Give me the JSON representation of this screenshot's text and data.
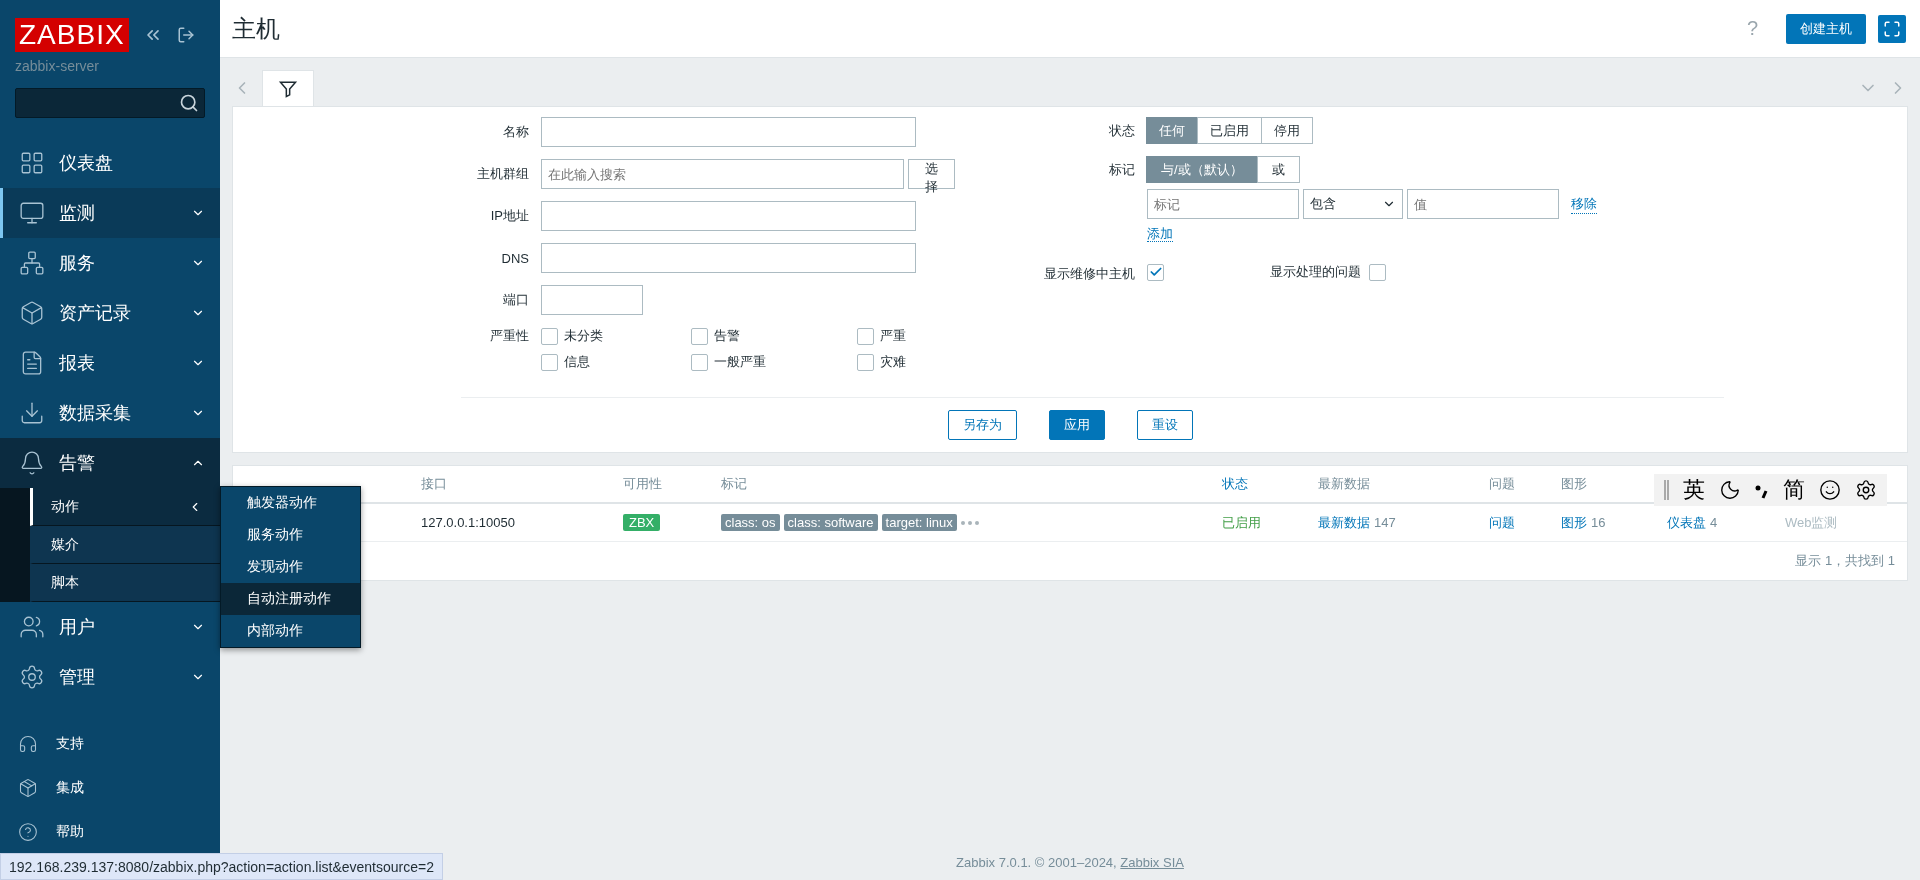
{
  "sidebar": {
    "logo": "ZABBIX",
    "server": "zabbix-server",
    "items": [
      {
        "label": "仪表盘",
        "selected": false,
        "expanded": false,
        "has_children": false
      },
      {
        "label": "监测",
        "selected": true,
        "expanded": false,
        "has_children": true
      },
      {
        "label": "服务",
        "selected": false,
        "expanded": false,
        "has_children": true
      },
      {
        "label": "资产记录",
        "selected": false,
        "expanded": false,
        "has_children": true
      },
      {
        "label": "报表",
        "selected": false,
        "expanded": false,
        "has_children": true
      },
      {
        "label": "数据采集",
        "selected": false,
        "expanded": false,
        "has_children": true
      },
      {
        "label": "告警",
        "selected": false,
        "expanded": true,
        "has_children": true,
        "children": [
          {
            "label": "动作",
            "selected": true,
            "has_submenu": true
          },
          {
            "label": "媒介",
            "selected": false,
            "has_submenu": false
          },
          {
            "label": "脚本",
            "selected": false,
            "has_submenu": false
          }
        ]
      },
      {
        "label": "用户",
        "selected": false,
        "expanded": false,
        "has_children": true
      },
      {
        "label": "管理",
        "selected": false,
        "expanded": false,
        "has_children": true
      }
    ],
    "bottom_items": [
      "支持",
      "集成",
      "帮助"
    ]
  },
  "popup_menu": [
    {
      "label": "触发器动作",
      "selected": false
    },
    {
      "label": "服务动作",
      "selected": false
    },
    {
      "label": "发现动作",
      "selected": false
    },
    {
      "label": "自动注册动作",
      "selected": true
    },
    {
      "label": "内部动作",
      "selected": false
    }
  ],
  "header": {
    "title": "主机",
    "help": "?",
    "create_button": "创建主机"
  },
  "filter": {
    "left": [
      {
        "label": "名称",
        "kind": "text"
      },
      {
        "label": "主机群组",
        "kind": "multiselect",
        "placeholder": "在此输入搜索",
        "button": "选择"
      },
      {
        "label": "IP地址",
        "kind": "text"
      },
      {
        "label": "DNS",
        "kind": "text"
      },
      {
        "label": "端口",
        "kind": "short"
      }
    ],
    "severity": {
      "label": "严重性",
      "options": [
        {
          "label": "未分类",
          "checked": false
        },
        {
          "label": "告警",
          "checked": false
        },
        {
          "label": "严重",
          "checked": false
        },
        {
          "label": "信息",
          "checked": false
        },
        {
          "label": "一般严重",
          "checked": false
        },
        {
          "label": "灾难",
          "checked": false
        }
      ]
    },
    "status": {
      "label": "状态",
      "options": [
        {
          "label": "任何",
          "selected": true
        },
        {
          "label": "已启用",
          "selected": false
        },
        {
          "label": "停用",
          "selected": false
        }
      ]
    },
    "tags": {
      "label": "标记",
      "options": [
        {
          "label": "与/或（默认）",
          "selected": true
        },
        {
          "label": "或",
          "selected": false
        }
      ],
      "tag_placeholder": "标记",
      "operator": "包含",
      "value_placeholder": "值",
      "remove": "移除",
      "add": "添加"
    },
    "maintenance": {
      "label": "显示维修中主机",
      "checked": true
    },
    "suppressed": {
      "label": "显示处理的问题",
      "checked": false
    },
    "buttons": [
      {
        "label": "另存为",
        "kind": "secondary"
      },
      {
        "label": "应用",
        "kind": "primary"
      },
      {
        "label": "重设",
        "kind": "secondary"
      }
    ]
  },
  "table": {
    "columns": [
      {
        "label": "接口",
        "sortable": false
      },
      {
        "label": "可用性",
        "sortable": false
      },
      {
        "label": "标记",
        "sortable": false
      },
      {
        "label": "状态",
        "sortable": true
      },
      {
        "label": "最新数据",
        "sortable": false
      },
      {
        "label": "问题",
        "sortable": false
      },
      {
        "label": "图形",
        "sortable": false
      }
    ],
    "rows": [
      {
        "interface": "127.0.0.1:10050",
        "availability": {
          "label": "ZBX",
          "color": "#34af67"
        },
        "tags": [
          "class: os",
          "class: software",
          "target: linux"
        ],
        "status": "已启用",
        "latest": {
          "link": "最新数据",
          "count": "147"
        },
        "problems": "问题",
        "graphs": {
          "link": "图形",
          "count": "16"
        },
        "dashboards": {
          "link": "仪表盘",
          "count": "4"
        },
        "web": "Web监测"
      }
    ],
    "footer": "显示 1，共找到 1"
  },
  "ime_toolbar": {
    "mode": "英",
    "script": "简"
  },
  "page_footer": {
    "text": "Zabbix 7.0.1. © 2001–2024, ",
    "link": "Zabbix SIA"
  },
  "status_url": "192.168.239.137:8080/zabbix.php?action=action.list&eventsource=2"
}
